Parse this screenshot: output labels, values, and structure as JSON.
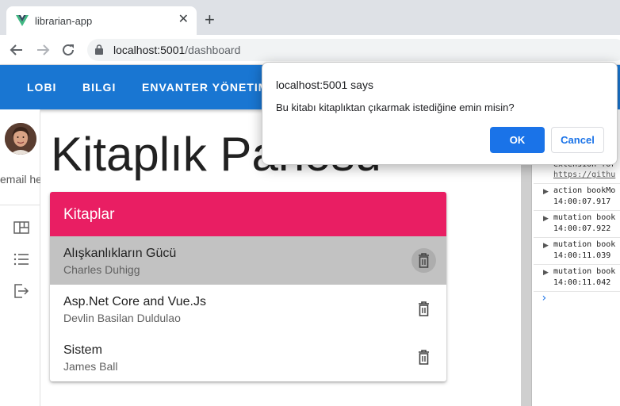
{
  "browser": {
    "tab_title": "librarian-app",
    "tab_close": "✕",
    "new_tab": "+",
    "url_host": "localhost:5001",
    "url_path": "/dashboard"
  },
  "appbar": {
    "items": [
      "LOBI",
      "BILGI",
      "ENVANTER YÖNETIM"
    ]
  },
  "drawer": {
    "email_fragment": "email her"
  },
  "page": {
    "title": "Kitaplık Panosu"
  },
  "card": {
    "title": "Kitaplar",
    "books": [
      {
        "title": "Alışkanlıkların Gücü",
        "author": "Charles Duhigg"
      },
      {
        "title": "Asp.Net Core and Vue.Js",
        "author": "Devlin Basilan Duldulao"
      },
      {
        "title": "Sistem",
        "author": "James Ball"
      }
    ]
  },
  "devtools": {
    "lines": [
      "extension for",
      "https://githu",
      "action bookMo",
      "14:00:07.917",
      "mutation book",
      "14:00:07.922",
      "mutation book",
      "14:00:11.039",
      "mutation book",
      "14:00:11.042"
    ],
    "prompt": "›"
  },
  "dialog": {
    "origin": "localhost:5001 says",
    "message": "Bu kitabı kitaplıktan çıkarmak istediğine emin misin?",
    "ok_label": "OK",
    "cancel_label": "Cancel"
  },
  "colors": {
    "appbar": "#1976d2",
    "card_header": "#e91e63",
    "dialog_ok": "#1a73e8"
  }
}
